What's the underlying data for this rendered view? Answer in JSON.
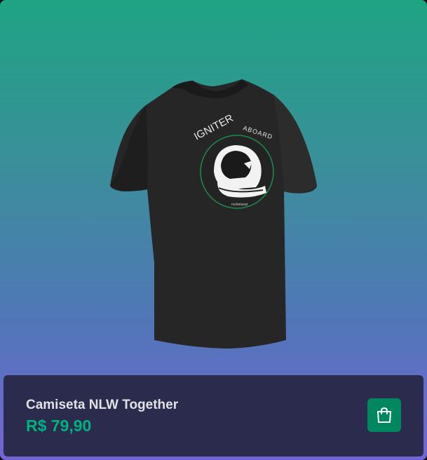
{
  "product": {
    "name": "Camiseta NLW Together",
    "price": "R$ 79,90",
    "image_icon": "tshirt-image",
    "print": {
      "title": "IGNITER",
      "subtitle": "ABOARD",
      "brand": "rocketseat"
    }
  },
  "cart": {
    "icon": "shopping-bag-icon"
  },
  "colors": {
    "price": "#00b37e",
    "button": "#00875f",
    "footer": "#2b2b4d",
    "gradient_top": "#1ea483",
    "gradient_bottom": "#7465d4"
  }
}
